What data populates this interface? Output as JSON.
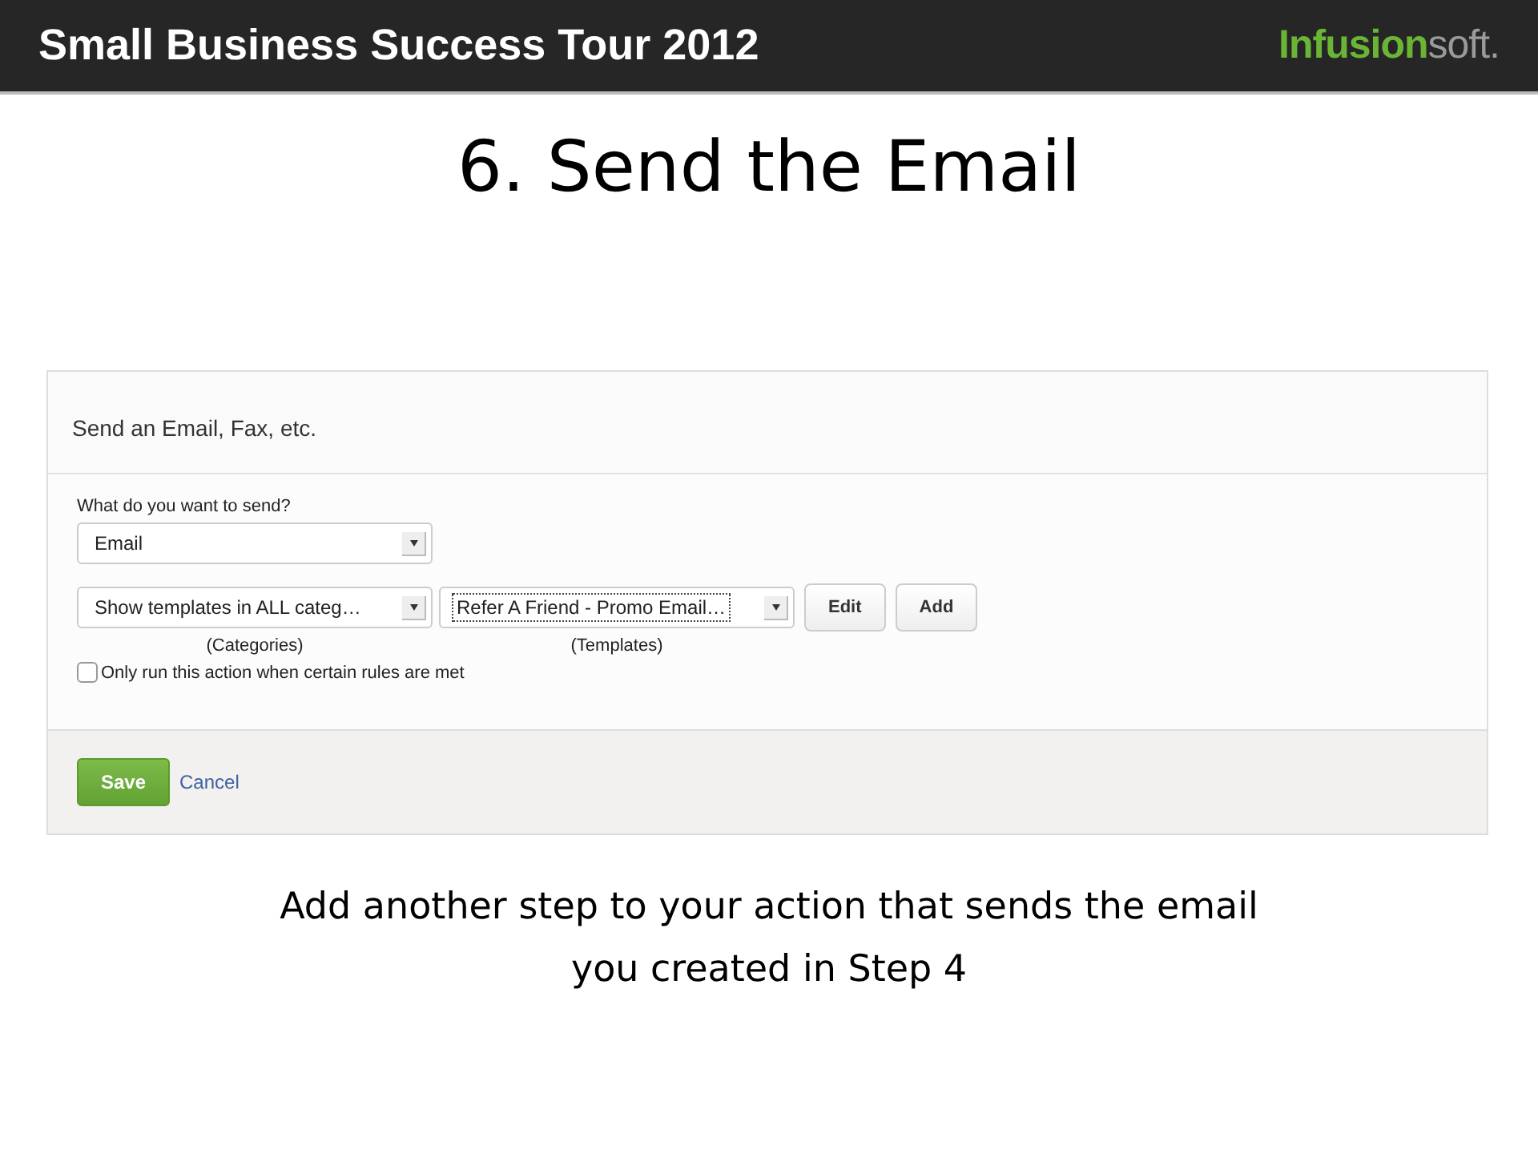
{
  "header": {
    "title": "Small Business Success Tour 2012",
    "logo": {
      "primary": "Infusion",
      "secondary": "soft."
    }
  },
  "slide_title": "6. Send the Email",
  "panel": {
    "title": "Send an Email, Fax, etc.",
    "send_label": "What do you want to send?",
    "send_select": {
      "value": "Email",
      "focused": false
    },
    "selects": [
      {
        "value": "Show templates in ALL categ…",
        "caption": "(Categories)",
        "focused": false
      },
      {
        "value": "Refer A Friend - Promo Email…",
        "caption": "(Templates)",
        "focused": true
      }
    ],
    "buttons": [
      "Edit",
      "Add"
    ],
    "rules_checkbox": {
      "label": "Only run this action when certain rules are met",
      "checked": false
    },
    "save": "Save",
    "cancel": "Cancel"
  },
  "caption": [
    "Add another step to your action that sends the email",
    "you created in Step 4"
  ]
}
